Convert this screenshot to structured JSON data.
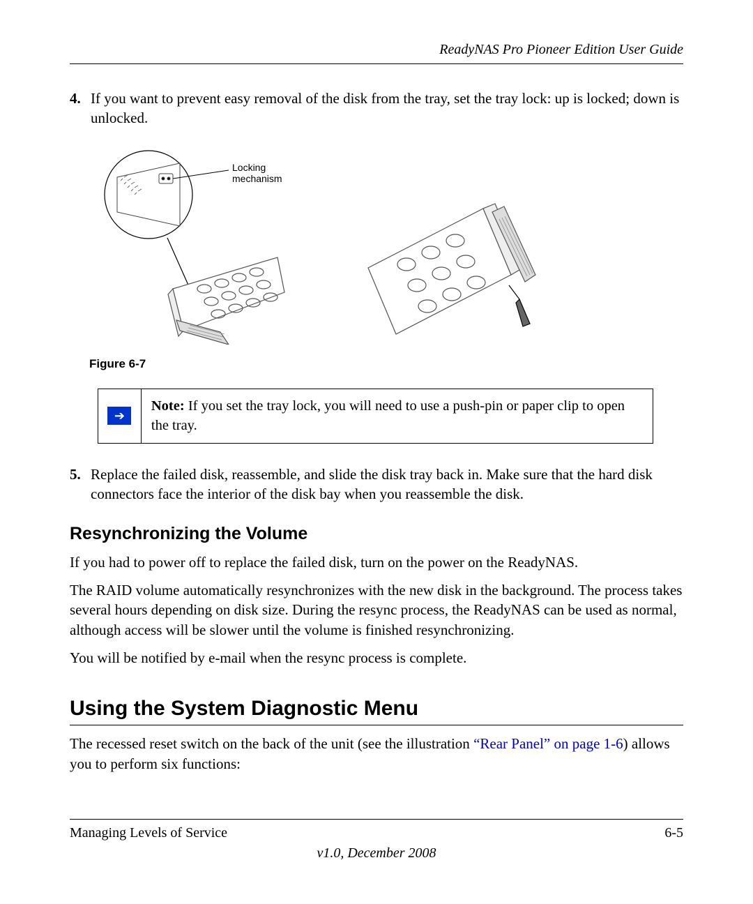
{
  "header": {
    "title": "ReadyNAS Pro Pioneer Edition User Guide"
  },
  "steps": [
    {
      "num": "4.",
      "text": "If you want to prevent easy removal of the disk from the tray, set the tray lock: up is locked; down is unlocked."
    },
    {
      "num": "5.",
      "text": "Replace the failed disk, reassemble, and slide the disk tray back in. Make sure that the hard disk connectors face the interior of the disk bay when you reassemble the disk."
    }
  ],
  "figure": {
    "callout_line1": "Locking",
    "callout_line2": "mechanism",
    "caption": "Figure 6-7"
  },
  "note": {
    "label": "Note:",
    "text": " If you set the tray lock, you will need to use a push-pin or paper clip to open the tray."
  },
  "subhead": "Resynchronizing the Volume",
  "paragraphs": {
    "p1": "If you had to power off to replace the failed disk, turn on the power on the ReadyNAS.",
    "p2": "The RAID volume automatically resynchronizes with the new disk in the background. The process takes several hours depending on disk size. During the resync process, the ReadyNAS can be used as normal, although access will be slower until the volume is finished resynchronizing.",
    "p3": "You will be notified by e-mail when the resync process is complete."
  },
  "section_title": "Using the System Diagnostic Menu",
  "diag_paragraph": {
    "pre": "The recessed reset switch on the back of the unit (see the illustration ",
    "link": "“Rear Panel” on page 1-6",
    "post": ") allows you to perform six functions:"
  },
  "footer": {
    "left": "Managing Levels of Service",
    "right": "6-5",
    "version": "v1.0, December 2008"
  }
}
